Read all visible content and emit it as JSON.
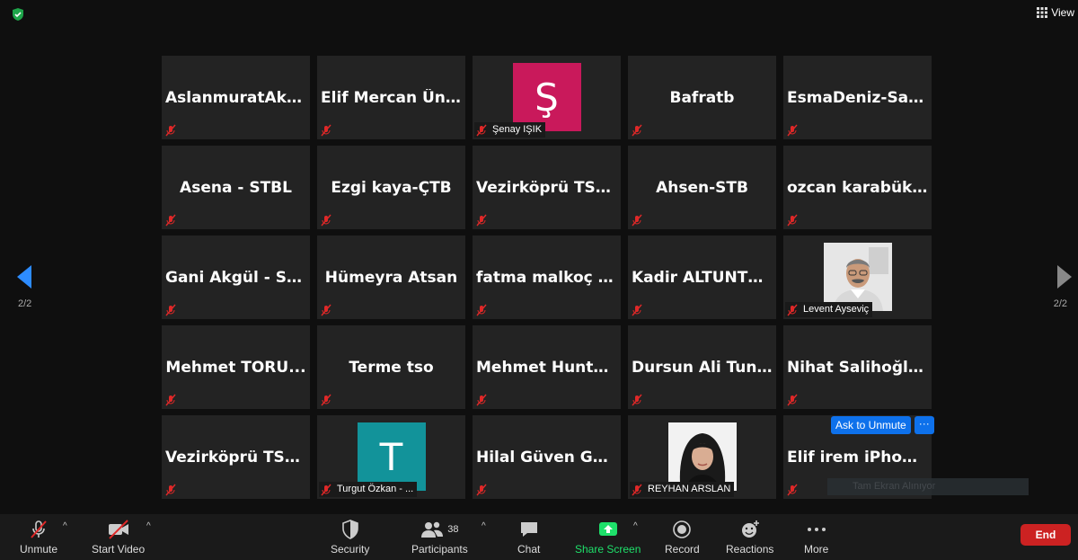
{
  "top": {
    "view_label": "View"
  },
  "pagination": {
    "left": "2/2",
    "right": "2/2"
  },
  "tiles": [
    {
      "name": "AslanmuratAks..."
    },
    {
      "name": "Elif  Mercan  Üny..."
    },
    {
      "avatar_letter": "Ş",
      "label": "Şenay IŞIK",
      "avatar_color": "#c9195b"
    },
    {
      "name": "Bafratb"
    },
    {
      "name": "EsmaDeniz-Sam..."
    },
    {
      "name": "Asena - STBL"
    },
    {
      "name": "Ezgi kaya-ÇTB"
    },
    {
      "name": "Vezirköprü  TSO..."
    },
    {
      "name": "Ahsen-STB"
    },
    {
      "name": "ozcan  karabük  -..."
    },
    {
      "name": "Gani  Akgül  -  ST..."
    },
    {
      "name": "Hümeyra Atsan"
    },
    {
      "name": "fatma  malkoç  a..."
    },
    {
      "name": "Kadir  ALTUNTE..."
    },
    {
      "label": "Levent Ayseviç"
    },
    {
      "name": "Mehmet  TORU..."
    },
    {
      "name": "Terme tso"
    },
    {
      "name": "Mehmet  Huntü..."
    },
    {
      "name": "Dursun  Ali  Tunç..."
    },
    {
      "name": "Nihat  Salihoğlu..."
    },
    {
      "name": "Vezirköprü  TSO..."
    },
    {
      "avatar_letter": "T",
      "label": "Turgut Özkan - ...",
      "avatar_color": "#12939a"
    },
    {
      "name": "Hilal  Güven  Gü..."
    },
    {
      "label": "REYHAN ARSLAN"
    },
    {
      "name": "Elif irem iPhone’u"
    }
  ],
  "ask_unmute": {
    "label": "Ask to Unmute",
    "more": "···"
  },
  "faint_bar": "Tam Ekran Alınıyor",
  "toolbar": {
    "unmute": "Unmute",
    "start_video": "Start Video",
    "security": "Security",
    "participants": "Participants",
    "participants_count": "38",
    "chat": "Chat",
    "share_screen": "Share Screen",
    "record": "Record",
    "reactions": "Reactions",
    "more": "More",
    "end": "End"
  },
  "colors": {
    "share_green": "#1ee06a",
    "accent_blue": "#0e71eb",
    "end_red": "#c22222"
  }
}
